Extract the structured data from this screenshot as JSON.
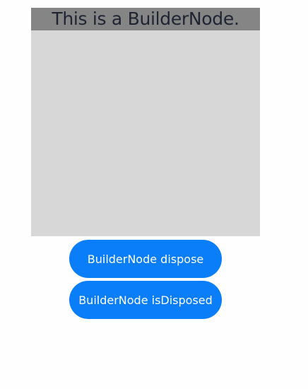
{
  "builder_node": {
    "title": "This is a BuilderNode."
  },
  "buttons": {
    "dispose_label": "BuilderNode dispose",
    "is_disposed_label": "BuilderNode isDisposed"
  },
  "colors": {
    "button_background": "#0a7ef8",
    "builder_area_background": "#d7d7d7",
    "builder_header_background": "#858585",
    "page_background": "#fefefe"
  }
}
